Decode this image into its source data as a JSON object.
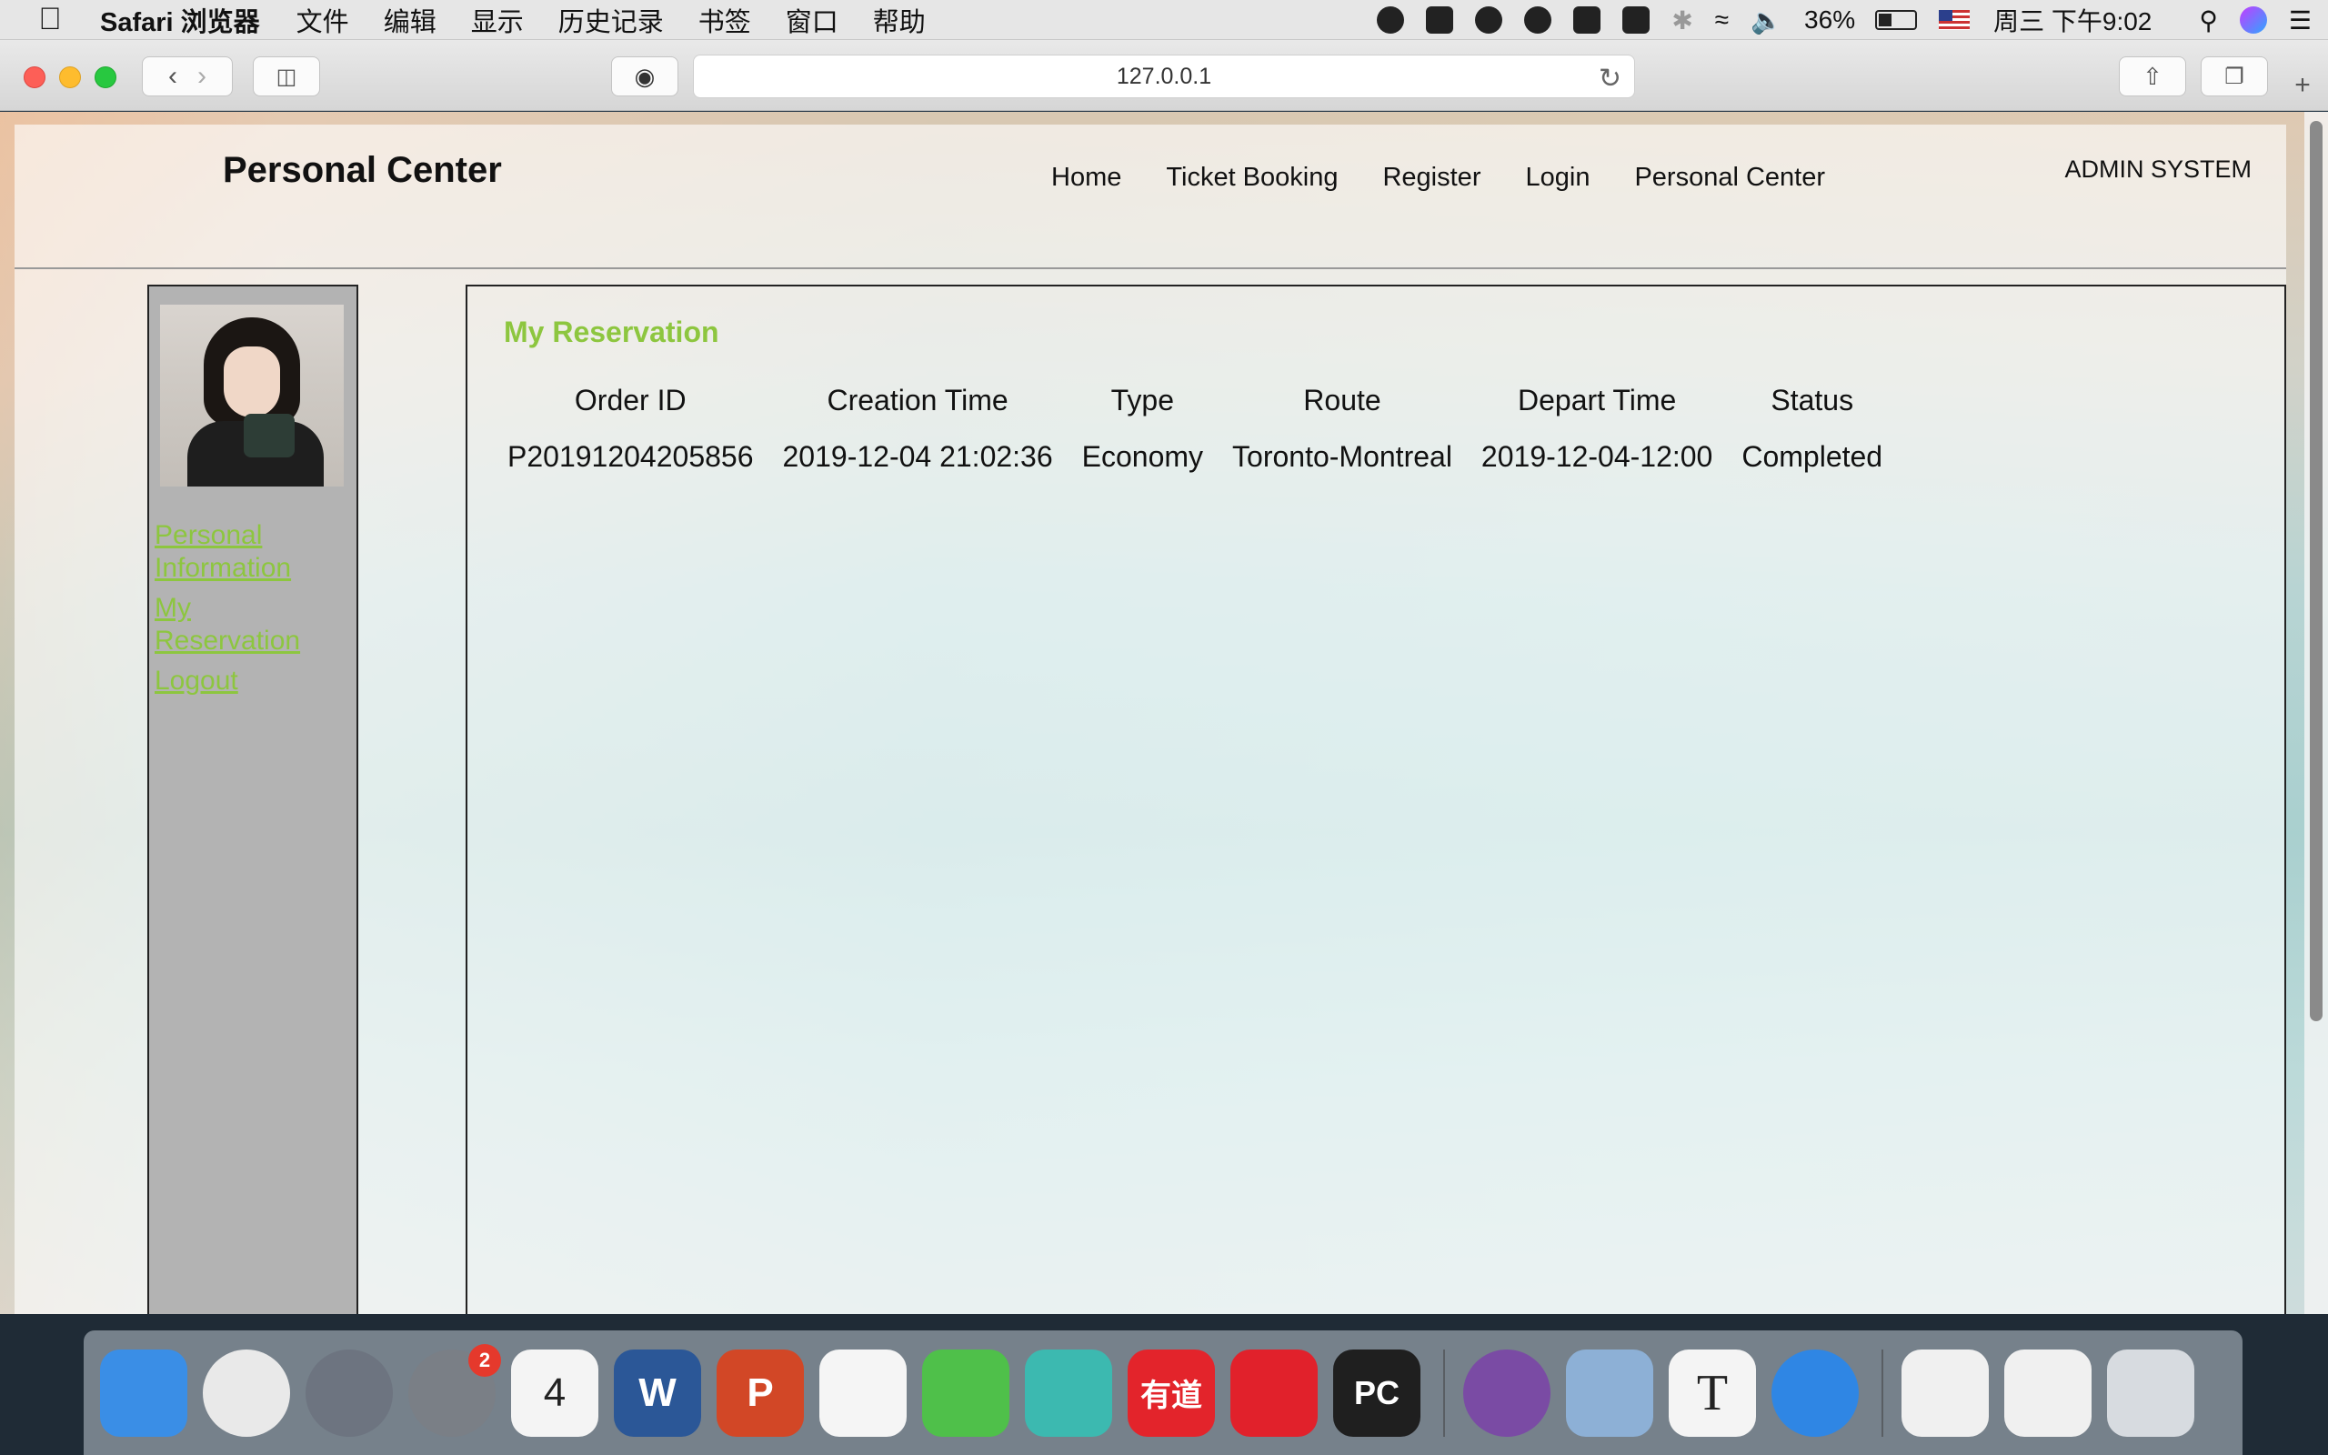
{
  "menubar": {
    "app_name": "Safari 浏览器",
    "items": [
      "文件",
      "编辑",
      "显示",
      "历史记录",
      "书签",
      "窗口",
      "帮助"
    ],
    "battery": "36%",
    "clock": "周三 下午9:02"
  },
  "browser": {
    "url": "127.0.0.1"
  },
  "site": {
    "title": "Personal Center",
    "nav": [
      "Home",
      "Ticket Booking",
      "Register",
      "Login",
      "Personal Center"
    ],
    "admin_link": "ADMIN SYSTEM"
  },
  "sidebar": {
    "links": [
      "Personal Information",
      "My Reservation",
      "Logout"
    ]
  },
  "main": {
    "section_title": "My Reservation",
    "columns": [
      "Order ID",
      "Creation Time",
      "Type",
      "Route",
      "Depart Time",
      "Status"
    ],
    "rows": [
      [
        "P20191204205856",
        "2019-12-04 21:02:36",
        "Economy",
        "Toronto-Montreal",
        "2019-12-04-12:00",
        "Completed"
      ]
    ]
  },
  "dock": {
    "apps": [
      {
        "name": "finder-icon",
        "label": "",
        "color": "#3a8ee6"
      },
      {
        "name": "chrome-icon",
        "label": "",
        "color": "#e9e9e9"
      },
      {
        "name": "launchpad-icon",
        "label": "",
        "color": "#6d7480"
      },
      {
        "name": "system-preferences-icon",
        "label": "",
        "color": "#7a7f86",
        "badge": "2"
      },
      {
        "name": "calendar-icon",
        "label": "4",
        "color": "#f4f4f4"
      },
      {
        "name": "word-icon",
        "label": "W",
        "color": "#2b5797"
      },
      {
        "name": "powerpoint-icon",
        "label": "P",
        "color": "#d24726"
      },
      {
        "name": "qq-icon",
        "label": "",
        "color": "#f5f5f5"
      },
      {
        "name": "wechat-icon",
        "label": "",
        "color": "#4fc04a"
      },
      {
        "name": "screenshot-app-icon",
        "label": "",
        "color": "#3cb9b0"
      },
      {
        "name": "youdao-icon",
        "label": "有道",
        "color": "#e3242b"
      },
      {
        "name": "netease-music-icon",
        "label": "",
        "color": "#e1212b"
      },
      {
        "name": "pycharm-icon",
        "label": "PC",
        "color": "#1f1f1f"
      },
      {
        "name": "github-desktop-icon",
        "label": "",
        "color": "#7a4ba4"
      },
      {
        "name": "preview-icon",
        "label": "",
        "color": "#8db0d6"
      },
      {
        "name": "typora-icon",
        "label": "T",
        "color": "#f4f4f4"
      },
      {
        "name": "safari-icon",
        "label": "",
        "color": "#2f86e4"
      },
      {
        "name": "recent-window-1-icon",
        "label": "",
        "color": "#f0f0f0"
      },
      {
        "name": "recent-window-2-icon",
        "label": "",
        "color": "#f0f0f0"
      },
      {
        "name": "trash-icon",
        "label": "",
        "color": "#d7dbe0"
      }
    ]
  }
}
